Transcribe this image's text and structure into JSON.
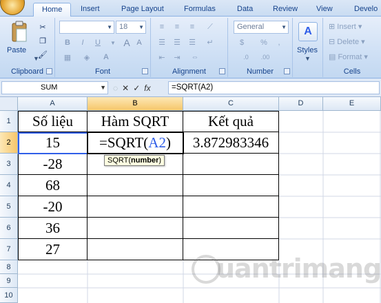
{
  "ribbon": {
    "tabs": [
      "Home",
      "Insert",
      "Page Layout",
      "Formulas",
      "Data",
      "Review",
      "View",
      "Develo"
    ],
    "groups": {
      "clipboard": {
        "label": "Clipboard",
        "paste_label": "Paste"
      },
      "font": {
        "label": "Font",
        "font_name": "",
        "font_size": "18",
        "bold": "B",
        "italic": "I",
        "underline": "U"
      },
      "alignment": {
        "label": "Alignment"
      },
      "number": {
        "label": "Number",
        "format": "General",
        "currency": "$",
        "percent": "%",
        "comma": ",",
        "inc_decimal": ".0",
        "dec_decimal": ".00"
      },
      "styles": {
        "label": "Styles"
      },
      "cells": {
        "label": "Cells",
        "insert": "Insert",
        "delete": "Delete",
        "format": "Format"
      }
    }
  },
  "formula_bar": {
    "name_box": "SUM",
    "formula": "=SQRT(A2)",
    "fx": "fx"
  },
  "sheet": {
    "columns": [
      "A",
      "B",
      "C",
      "D",
      "E"
    ],
    "rows": [
      "1",
      "2",
      "3",
      "4",
      "5",
      "6",
      "7",
      "8",
      "9",
      "10"
    ],
    "headers": {
      "a1": "Số liệu",
      "b1": "Hàm SQRT",
      "c1": "Kết quả"
    },
    "values": [
      "15",
      "-28",
      "68",
      "-20",
      "36",
      "27"
    ],
    "editing": {
      "prefix": "=SQRT(",
      "ref": "A2",
      "suffix": ")"
    },
    "c2": "3.872983346",
    "tooltip": {
      "fn": "SQRT(",
      "arg": "number",
      "close": ")"
    }
  },
  "watermark": "uantrimang",
  "colors": {
    "accent": "#15428b",
    "ref": "#2f5ee8",
    "selected_header": "#f6c66a"
  }
}
